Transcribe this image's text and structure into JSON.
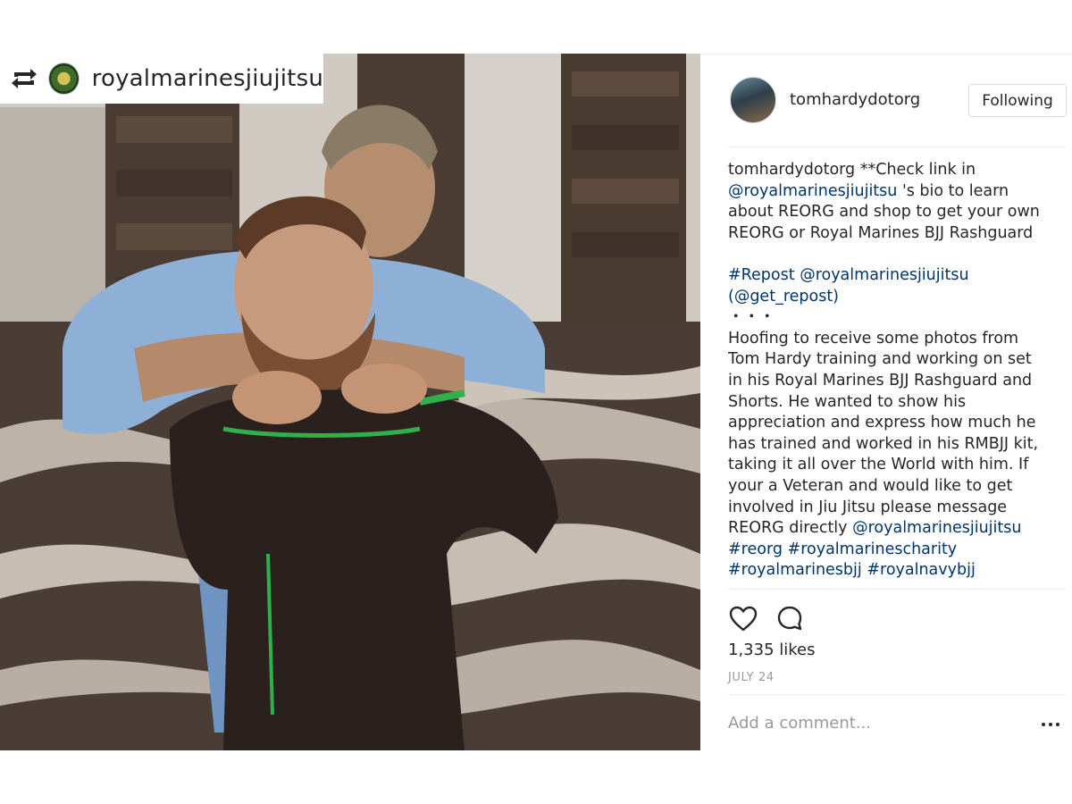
{
  "repost_badge": {
    "username": "royalmarinesjiujitsu",
    "repost_icon": "repost-icon"
  },
  "post": {
    "username": "tomhardydotorg",
    "follow_label": "Following",
    "caption": {
      "author": "tomhardydotorg",
      "line1": " **Check link in",
      "mention1": "@royalmarinesjiujitsu",
      "line2": " 's bio to learn about REORG and shop to get your own REORG or Royal Marines BJJ Rashguard",
      "repost_tag": "#Repost",
      "repost_mention": "@royalmarinesjiujitsu",
      "repost_via": "(@get_repost)",
      "dots": "・・・",
      "body": "Hoofing to receive some photos from Tom Hardy training and working on set in his Royal Marines BJJ Rashguard and Shorts. He wanted to show his appreciation and express how much he has trained and worked in his RMBJJ kit, taking it all over the World with him. If your a Veteran and would like to get involved in Jiu Jitsu please message REORG directly ",
      "mention2": "@royalmarinesjiujitsu",
      "hashtags": [
        "#reorg",
        "#royalmarinescharity",
        "#royalmarinesbjj",
        "#royalnavybjj"
      ]
    },
    "likes": "1,335 likes",
    "date": "JULY 24",
    "comment_placeholder": "Add a comment...",
    "icons": [
      "heart-icon",
      "comment-icon",
      "more-icon"
    ],
    "link_color": "#003569"
  }
}
